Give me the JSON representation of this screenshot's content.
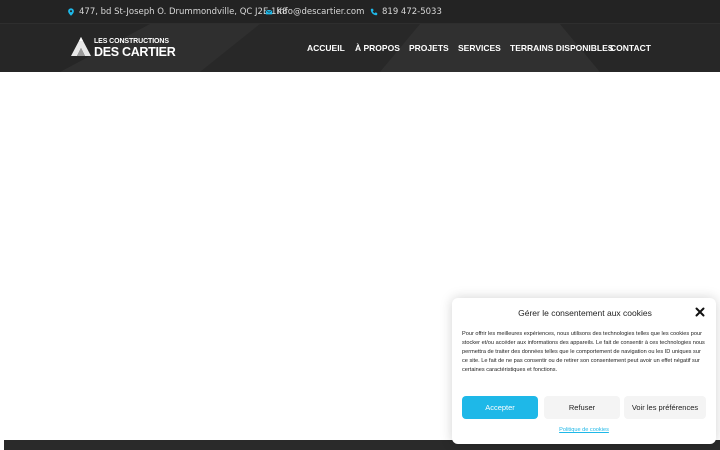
{
  "topbar": {
    "address": "477, bd St-Joseph O. Drummondville, QC J2E 1K8",
    "email": "info@descartier.com",
    "phone": "819 472-5033"
  },
  "logo": {
    "line1": "LES CONSTRUCTIONS",
    "line2": "DES CARTIER"
  },
  "nav": {
    "items": [
      "ACCUEIL",
      "À PROPOS",
      "PROJETS",
      "SERVICES",
      "TERRAINS DISPONIBLES",
      "CONTACT"
    ]
  },
  "cookie": {
    "title": "Gérer le consentement aux cookies",
    "body": "Pour offrir les meilleures expériences, nous utilisons des technologies telles que les cookies pour stocker et/ou accéder aux informations des appareils. Le fait de consentir à ces technologies nous permettra de traiter des données telles que le comportement de navigation ou les ID uniques sur ce site. Le fait de ne pas consentir ou de retirer son consentement peut avoir un effet négatif sur certaines caractéristiques et fonctions.",
    "accept": "Accepter",
    "refuse": "Refuser",
    "preferences": "Voir les préférences",
    "policy": "Politique de cookies"
  },
  "colors": {
    "topbar_bg": "#232323",
    "header_bg": "#2b2b2b",
    "accent": "#1eb8e8"
  },
  "icons": [
    "map-pin-icon",
    "envelope-icon",
    "phone-icon",
    "close-icon"
  ]
}
